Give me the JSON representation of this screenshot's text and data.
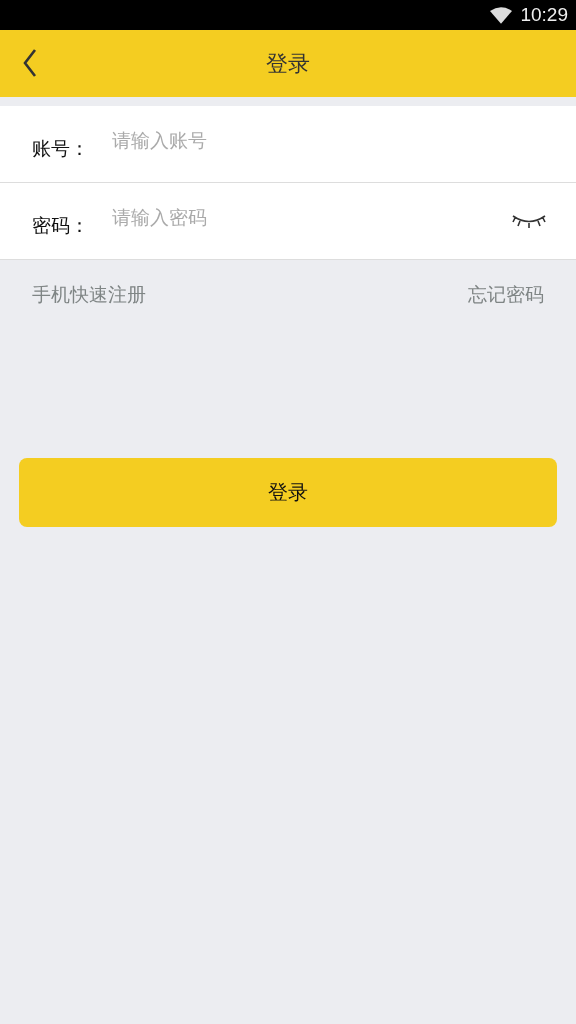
{
  "status_bar": {
    "time": "10:29"
  },
  "header": {
    "back": true,
    "title": "登录"
  },
  "fields": [
    {
      "label": "账号：",
      "placeholder": "请输入账号",
      "kind": "text"
    },
    {
      "label": "密码：",
      "placeholder": "请输入密码",
      "kind": "password"
    }
  ],
  "links": {
    "register": "手机快速注册",
    "forgot": "忘记密码"
  },
  "submit": "登录"
}
